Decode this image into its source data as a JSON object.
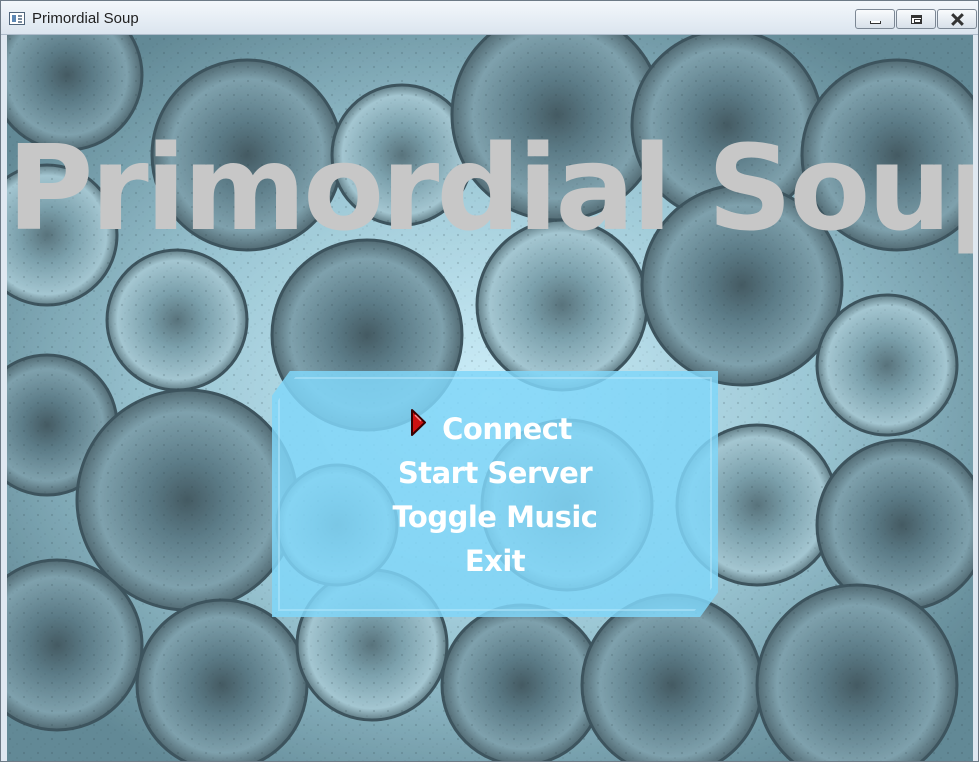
{
  "window": {
    "title": "Primordial Soup",
    "buttons": [
      "minimize-icon",
      "maximize-icon",
      "close-icon"
    ]
  },
  "game": {
    "title": "Primordial Soup",
    "menu": {
      "items": [
        {
          "label": "Connect",
          "selected": true
        },
        {
          "label": "Start Server",
          "selected": false
        },
        {
          "label": "Toggle Music",
          "selected": false
        },
        {
          "label": "Exit",
          "selected": false
        }
      ],
      "selector_icon": "red-arrow-icon"
    }
  },
  "colors": {
    "title_text": "#c7c7c7",
    "menu_panel": "#80d6f8",
    "menu_text": "#ffffff",
    "selector": "#cc1111",
    "background_tint": "#8fb6c4"
  }
}
